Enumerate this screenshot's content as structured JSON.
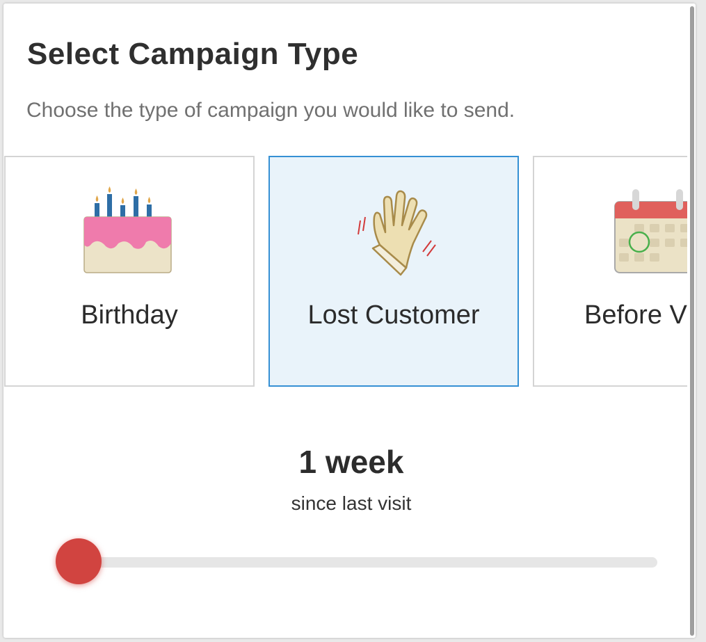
{
  "dialog": {
    "title": "Select Campaign Type",
    "subtitle": "Choose the type of campaign you would like to send."
  },
  "campaign_types": [
    {
      "label": "Birthday",
      "icon": "birthday-cake-icon",
      "selected": false
    },
    {
      "label": "Lost Customer",
      "icon": "waving-hand-icon",
      "selected": true
    },
    {
      "label": "Before Vi",
      "icon": "calendar-icon",
      "selected": false
    }
  ],
  "interval": {
    "value_label": "1 week",
    "caption": "since last visit",
    "slider_fraction": 0
  },
  "colors": {
    "accent": "#3590d4",
    "selected_bg": "#e9f3fa",
    "slider_thumb": "#d14440"
  }
}
